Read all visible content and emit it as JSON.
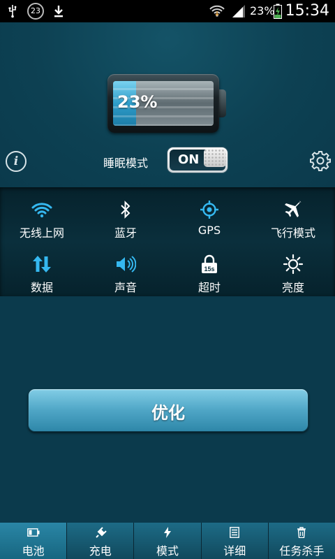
{
  "status_bar": {
    "notification_count": "23",
    "battery_percent": "23%",
    "time": "15:34"
  },
  "battery": {
    "level_percent": 23,
    "label": "23%"
  },
  "sleep_mode": {
    "label": "睡眠模式",
    "toggle_text": "ON",
    "state": true
  },
  "quick_settings": [
    {
      "label": "无线上网",
      "icon": "wifi-icon"
    },
    {
      "label": "蓝牙",
      "icon": "bluetooth-icon"
    },
    {
      "label": "GPS",
      "icon": "gps-icon"
    },
    {
      "label": "飞行模式",
      "icon": "airplane-icon"
    },
    {
      "label": "数据",
      "icon": "data-icon"
    },
    {
      "label": "声音",
      "icon": "sound-icon"
    },
    {
      "label": "超时",
      "icon": "timeout-icon"
    },
    {
      "label": "亮度",
      "icon": "brightness-icon"
    }
  ],
  "timeout_icon_text": "15s",
  "optimize_button": {
    "label": "优化"
  },
  "tabs": [
    {
      "label": "电池",
      "icon": "battery-icon",
      "active": true
    },
    {
      "label": "充电",
      "icon": "plug-icon",
      "active": false
    },
    {
      "label": "模式",
      "icon": "bolt-icon",
      "active": false
    },
    {
      "label": "详细",
      "icon": "list-icon",
      "active": false
    },
    {
      "label": "任务杀手",
      "icon": "trash-icon",
      "active": false
    }
  ],
  "colors": {
    "background": "#0b3a4c",
    "accent": "#2e9dc9",
    "icon_blue": "#35b8f0",
    "tab": "#1d6b86"
  }
}
